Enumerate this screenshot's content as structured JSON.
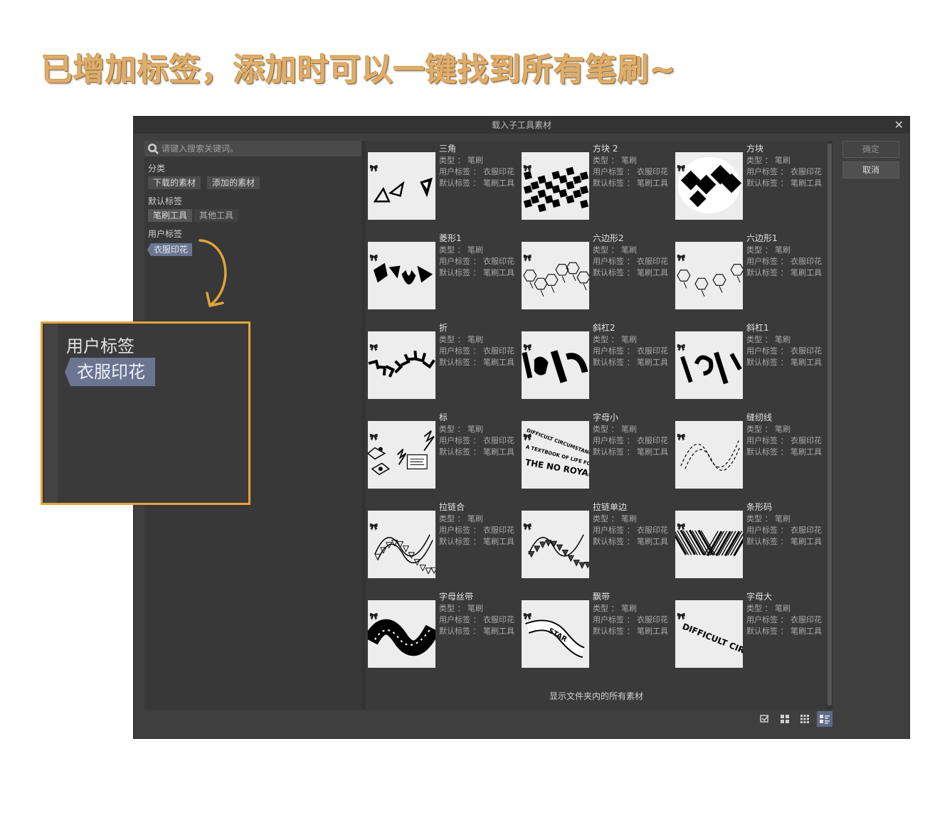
{
  "headline": "已增加标签，添加时可以一键找到所有笔刷~",
  "dialog": {
    "title": "载入子工具素材",
    "close_glyph": "✕",
    "search_placeholder": "请键入搜索关键词。",
    "category_label": "分类",
    "category_chips": [
      "下载的素材",
      "添加的素材"
    ],
    "default_tags_label": "默认标签",
    "default_tag_chips": [
      "笔刷工具",
      "其他工具"
    ],
    "user_tags_label": "用户标签",
    "user_tag_chip": "衣服印花",
    "ok_button": "确定",
    "cancel_button": "取消",
    "footer_note": "显示文件夹内的所有素材",
    "view_icons": [
      "checkbox-list-icon",
      "large-grid-icon",
      "small-grid-icon",
      "detail-list-icon"
    ]
  },
  "zoom_callout": {
    "label": "用户标签",
    "tag": "衣服印花"
  },
  "materials": [
    {
      "name": "三角",
      "type": "类型 ： 笔刷",
      "user_tag": "用户标签 ： 衣服印花",
      "default_tag": "默认标签 ： 笔刷工具"
    },
    {
      "name": "方块 2",
      "type": "类型 ： 笔刷",
      "user_tag": "用户标签 ： 衣服印花",
      "default_tag": "默认标签 ： 笔刷工具"
    },
    {
      "name": "方块",
      "type": "类型 ： 笔刷",
      "user_tag": "用户标签 ： 衣服印花",
      "default_tag": "默认标签 ： 笔刷工具"
    },
    {
      "name": "菱形1",
      "type": "类型 ： 笔刷",
      "user_tag": "用户标签 ： 衣服印花",
      "default_tag": "默认标签 ： 笔刷工具"
    },
    {
      "name": "六边形2",
      "type": "类型 ： 笔刷",
      "user_tag": "用户标签 ： 衣服印花",
      "default_tag": "默认标签 ： 笔刷工具"
    },
    {
      "name": "六边形1",
      "type": "类型 ： 笔刷",
      "user_tag": "用户标签 ： 衣服印花",
      "default_tag": "默认标签 ： 笔刷工具"
    },
    {
      "name": "折",
      "type": "类型 ： 笔刷",
      "user_tag": "用户标签 ： 衣服印花",
      "default_tag": "默认标签 ： 笔刷工具"
    },
    {
      "name": "斜杠2",
      "type": "类型 ： 笔刷",
      "user_tag": "用户标签 ： 衣服印花",
      "default_tag": "默认标签 ： 笔刷工具"
    },
    {
      "name": "斜杠1",
      "type": "类型 ： 笔刷",
      "user_tag": "用户标签 ： 衣服印花",
      "default_tag": "默认标签 ： 笔刷工具"
    },
    {
      "name": "标",
      "type": "类型 ： 笔刷",
      "user_tag": "用户标签 ： 衣服印花",
      "default_tag": "默认标签 ： 笔刷工具"
    },
    {
      "name": "字母小",
      "type": "类型 ： 笔刷",
      "user_tag": "用户标签 ： 衣服印花",
      "default_tag": "默认标签 ： 笔刷工具",
      "thumb_text": [
        "DIFFICULT CIRCUMSTANCES",
        "A TEXTBOOK OF LIFE FOR PEOPLE",
        "THE NO ROYAL"
      ]
    },
    {
      "name": "缝纫线",
      "type": "类型 ： 笔刷",
      "user_tag": "用户标签 ： 衣服印花",
      "default_tag": "默认标签 ： 笔刷工具"
    },
    {
      "name": "拉链合",
      "type": "类型 ： 笔刷",
      "user_tag": "用户标签 ： 衣服印花",
      "default_tag": "默认标签 ： 笔刷工具"
    },
    {
      "name": "拉链单边",
      "type": "类型 ： 笔刷",
      "user_tag": "用户标签 ： 衣服印花",
      "default_tag": "默认标签 ： 笔刷工具"
    },
    {
      "name": "条形码",
      "type": "类型 ： 笔刷",
      "user_tag": "用户标签 ： 衣服印花",
      "default_tag": "默认标签 ： 笔刷工具"
    },
    {
      "name": "字母丝带",
      "type": "类型 ： 笔刷",
      "user_tag": "用户标签 ： 衣服印花",
      "default_tag": "默认标签 ： 笔刷工具"
    },
    {
      "name": "飘带",
      "type": "类型 ： 笔刷",
      "user_tag": "用户标签 ： 衣服印花",
      "default_tag": "默认标签 ： 笔刷工具",
      "thumb_text": [
        "STAR"
      ]
    },
    {
      "name": "字母大",
      "type": "类型 ： 笔刷",
      "user_tag": "用户标签 ： 衣服印花",
      "default_tag": "默认标签 ： 笔刷工具",
      "thumb_text": [
        "DIFFICULT CIRC"
      ]
    }
  ]
}
